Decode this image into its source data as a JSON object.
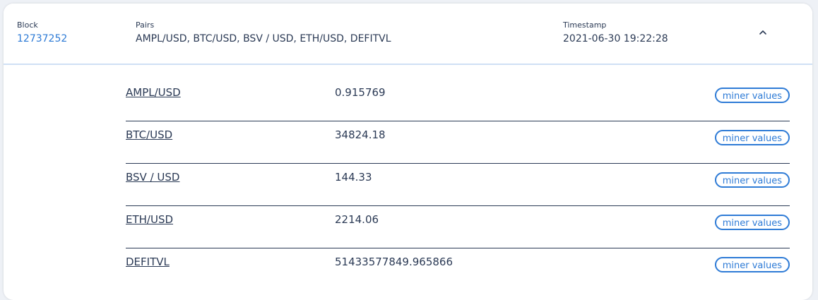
{
  "header": {
    "block_label": "Block",
    "block_value": "12737252",
    "pairs_label": "Pairs",
    "pairs_value": "AMPL/USD, BTC/USD, BSV / USD, ETH/USD, DEFITVL",
    "timestamp_label": "Timestamp",
    "timestamp_value": "2021-06-30 19:22:28",
    "toggle_icon": "chevron-up-icon"
  },
  "rows": [
    {
      "pair": "AMPL/USD",
      "value": "0.915769",
      "button": "miner values"
    },
    {
      "pair": "BTC/USD",
      "value": "34824.18",
      "button": "miner values"
    },
    {
      "pair": "BSV / USD",
      "value": "144.33",
      "button": "miner values"
    },
    {
      "pair": "ETH/USD",
      "value": "2214.06",
      "button": "miner values"
    },
    {
      "pair": "DEFITVL",
      "value": "51433577849.965866",
      "button": "miner values"
    }
  ],
  "colors": {
    "accent": "#2e7bd6",
    "text": "#2b3a55",
    "divider": "#cfe0f5"
  }
}
